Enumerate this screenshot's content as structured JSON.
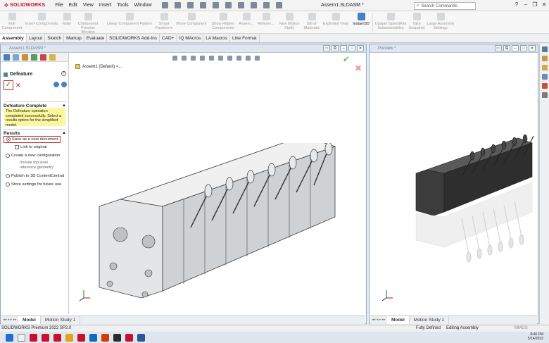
{
  "app": {
    "brand": "SOLIDWORKS",
    "doc_title": "Assem1.SLDASM *"
  },
  "menu": [
    "File",
    "Edit",
    "View",
    "Insert",
    "Tools",
    "Window"
  ],
  "search": {
    "placeholder": "Search Commands"
  },
  "ribbon": [
    {
      "label": "Edit Component",
      "active": false
    },
    {
      "label": "Insert Components",
      "active": false
    },
    {
      "label": "Mate",
      "active": false
    },
    {
      "label": "Component Preview Window",
      "active": false
    },
    {
      "label": "Linear Component Pattern",
      "active": false
    },
    {
      "label": "Smart Fasteners",
      "active": false
    },
    {
      "label": "Move Component",
      "active": false
    },
    {
      "label": "Show Hidden Components",
      "active": false
    },
    {
      "label": "Assem...",
      "active": false
    },
    {
      "label": "Referen...",
      "active": false
    },
    {
      "label": "New Motion Study",
      "active": false
    },
    {
      "label": "Bill of Materials",
      "active": false
    },
    {
      "label": "Exploded View",
      "active": false
    },
    {
      "label": "Instant3D",
      "active": true
    },
    {
      "label": "Update SpeedPak Subassemblies",
      "active": false
    },
    {
      "label": "Take Snapshot",
      "active": false
    },
    {
      "label": "Large Assembly Settings",
      "active": false
    }
  ],
  "cmd_tabs": [
    "Assembly",
    "Layout",
    "Sketch",
    "Markup",
    "Evaluate",
    "SOLIDWORKS Add-Ins",
    "CAD+",
    "IQ MAcros",
    "LA Macros",
    "Line Format"
  ],
  "left_window": {
    "caption": "Assem1.SLDASM *",
    "tree_item": "Assem1 (Default) <..."
  },
  "pm": {
    "title": "Defeature",
    "help": "?",
    "ok": "✓",
    "cancel": "✕",
    "complete_header": "Defeature Complete",
    "message": "The Defeature operation completed successfully. Select a results option for the simplified model.",
    "results_header": "Results",
    "options": [
      {
        "label": "Save as a new document",
        "type": "radio",
        "checked": true
      },
      {
        "label": "Link to original",
        "type": "check",
        "checked": false
      },
      {
        "label": "Create a new configuration",
        "type": "radio",
        "checked": false
      },
      {
        "label": "Include top level reference geometry",
        "type": "sub",
        "checked": false
      },
      {
        "label": "Publish to 3D ContentCentral",
        "type": "radio",
        "checked": false
      },
      {
        "label": "Store settings for future use",
        "type": "radio",
        "checked": false
      }
    ]
  },
  "left_tabs": [
    "Model",
    "Motion Study 1"
  ],
  "right_window": {
    "caption": "Preview *"
  },
  "right_tabs": [
    "Model",
    "Motion Study 1"
  ],
  "status": {
    "left": "SOLIDWORKS Premium 2022 SP2.0",
    "defined": "Fully Defined",
    "editing": "Editing Assembly",
    "units": "MMGS"
  },
  "clock": {
    "time": "8:40 PM",
    "date": "5/14/2022"
  },
  "colors": {
    "accent": "#c8102e",
    "frame": "#8fa8c6",
    "message_bg": "#fbf79f",
    "highlight": "#d12a2a"
  },
  "icons": [
    "search-icon",
    "ok-check-icon",
    "cancel-x-icon",
    "help-icon",
    "triad-icon",
    "axis-icon"
  ]
}
